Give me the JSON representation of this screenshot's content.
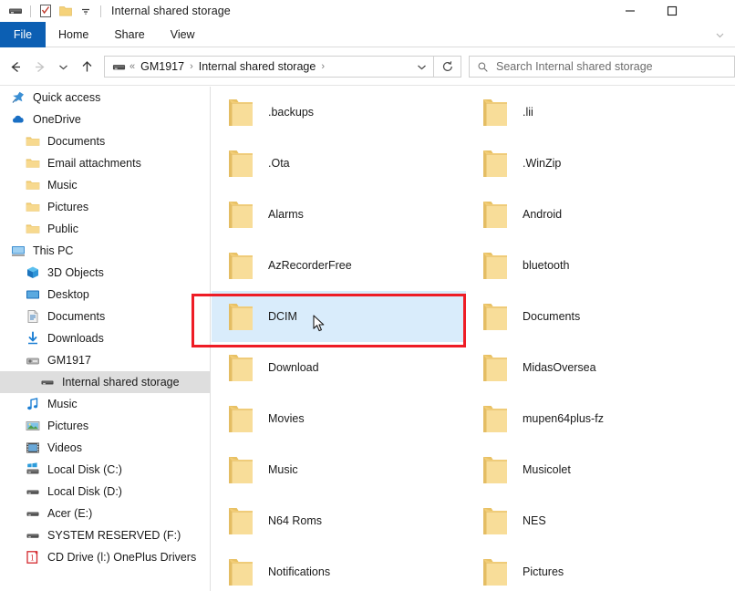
{
  "window": {
    "title": "Internal shared storage",
    "quick_access_icons": [
      "drive-icon",
      "properties-checkbox-icon",
      "new-folder-icon",
      "customize-chevron-icon"
    ],
    "controls": {
      "minimize": "minimize-button",
      "maximize": "maximize-button"
    }
  },
  "ribbon": {
    "tabs": [
      {
        "label": "File",
        "active": true
      },
      {
        "label": "Home",
        "active": false
      },
      {
        "label": "Share",
        "active": false
      },
      {
        "label": "View",
        "active": false
      }
    ],
    "expand_icon": "chevron-down-icon"
  },
  "navigation": {
    "back": "back-arrow-icon",
    "forward": "forward-arrow-icon",
    "recent": "recent-locations-chevron-icon",
    "up": "up-arrow-icon",
    "refresh": "refresh-icon",
    "breadcrumb": {
      "device_icon": "drive-icon",
      "overflow": "«",
      "items": [
        "GM1917",
        "Internal shared storage"
      ],
      "separator": "›",
      "dropdown": "chevron-down-icon"
    }
  },
  "search": {
    "icon": "search-icon",
    "placeholder": "Search Internal shared storage",
    "value": ""
  },
  "sidebar": {
    "items": [
      {
        "label": "Quick access",
        "icon": "pin-star-icon",
        "indent": 0,
        "selected": false
      },
      {
        "label": "OneDrive",
        "icon": "cloud-icon",
        "indent": 0,
        "selected": false
      },
      {
        "label": "Documents",
        "icon": "folder-icon",
        "indent": 1,
        "selected": false
      },
      {
        "label": "Email attachments",
        "icon": "folder-icon",
        "indent": 1,
        "selected": false
      },
      {
        "label": "Music",
        "icon": "folder-icon",
        "indent": 1,
        "selected": false
      },
      {
        "label": "Pictures",
        "icon": "folder-icon",
        "indent": 1,
        "selected": false
      },
      {
        "label": "Public",
        "icon": "folder-icon",
        "indent": 1,
        "selected": false
      },
      {
        "label": "This PC",
        "icon": "monitor-icon",
        "indent": 0,
        "selected": false
      },
      {
        "label": "3D Objects",
        "icon": "cube-icon",
        "indent": 1,
        "selected": false
      },
      {
        "label": "Desktop",
        "icon": "desktop-icon",
        "indent": 1,
        "selected": false
      },
      {
        "label": "Documents",
        "icon": "document-icon",
        "indent": 1,
        "selected": false
      },
      {
        "label": "Downloads",
        "icon": "download-icon",
        "indent": 1,
        "selected": false
      },
      {
        "label": "GM1917",
        "icon": "phone-device-icon",
        "indent": 1,
        "selected": false
      },
      {
        "label": "Internal shared storage",
        "icon": "storage-icon",
        "indent": 2,
        "selected": true
      },
      {
        "label": "Music",
        "icon": "music-note-icon",
        "indent": 1,
        "selected": false
      },
      {
        "label": "Pictures",
        "icon": "picture-icon",
        "indent": 1,
        "selected": false
      },
      {
        "label": "Videos",
        "icon": "video-icon",
        "indent": 1,
        "selected": false
      },
      {
        "label": "Local Disk (C:)",
        "icon": "windows-drive-icon",
        "indent": 1,
        "selected": false
      },
      {
        "label": "Local Disk (D:)",
        "icon": "drive-icon",
        "indent": 1,
        "selected": false
      },
      {
        "label": "Acer (E:)",
        "icon": "drive-icon",
        "indent": 1,
        "selected": false
      },
      {
        "label": "SYSTEM RESERVED (F:)",
        "icon": "drive-icon",
        "indent": 1,
        "selected": false
      },
      {
        "label": "CD Drive (l:) OnePlus Drivers",
        "icon": "cd-drive-icon",
        "indent": 1,
        "selected": false
      }
    ]
  },
  "files": {
    "items": [
      {
        "name": ".backups",
        "icon": "folder-icon",
        "hover": false
      },
      {
        "name": ".lii",
        "icon": "folder-icon",
        "hover": false
      },
      {
        "name": ".Ota",
        "icon": "folder-icon",
        "hover": false
      },
      {
        "name": ".WinZip",
        "icon": "folder-icon",
        "hover": false
      },
      {
        "name": "Alarms",
        "icon": "folder-icon",
        "hover": false
      },
      {
        "name": "Android",
        "icon": "folder-icon",
        "hover": false
      },
      {
        "name": "AzRecorderFree",
        "icon": "folder-icon",
        "hover": false
      },
      {
        "name": "bluetooth",
        "icon": "folder-icon",
        "hover": false
      },
      {
        "name": "DCIM",
        "icon": "folder-icon",
        "hover": true
      },
      {
        "name": "Documents",
        "icon": "folder-icon",
        "hover": false
      },
      {
        "name": "Download",
        "icon": "folder-icon",
        "hover": false
      },
      {
        "name": "MidasOversea",
        "icon": "folder-icon",
        "hover": false
      },
      {
        "name": "Movies",
        "icon": "folder-icon",
        "hover": false
      },
      {
        "name": "mupen64plus-fz",
        "icon": "folder-icon",
        "hover": false
      },
      {
        "name": "Music",
        "icon": "folder-icon",
        "hover": false
      },
      {
        "name": "Musicolet",
        "icon": "folder-icon",
        "hover": false
      },
      {
        "name": "N64 Roms",
        "icon": "folder-icon",
        "hover": false
      },
      {
        "name": "NES",
        "icon": "folder-icon",
        "hover": false
      },
      {
        "name": "Notifications",
        "icon": "folder-icon",
        "hover": false
      },
      {
        "name": "Pictures",
        "icon": "folder-icon",
        "hover": false
      }
    ]
  },
  "annotation": {
    "highlight_color": "#ee1c25",
    "target": "DCIM",
    "cursor": "mouse-pointer-icon"
  },
  "colors": {
    "file_tab": "#0c5fb3",
    "hover_row": "#d9ecfb",
    "selected_sidebar": "#dedede",
    "folder_yellow": "#f5cf72"
  }
}
